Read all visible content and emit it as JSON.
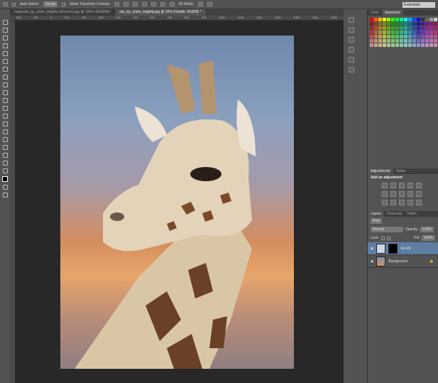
{
  "options": {
    "auto_select": "Auto-Select:",
    "group": "Group",
    "show_transform": "Show Transform Controls",
    "mode3d": "3D Mode:",
    "workspace": "Essentials"
  },
  "tabs": [
    {
      "label": "hogwarts_by_shine_brightly-d2yexm1.jpg @ 100% (RGB/8#)"
    },
    {
      "label": "sky_by_shine_brightly.jpg @ 25% (Giraffe, RGB/8) *"
    }
  ],
  "ruler": [
    "200",
    "100",
    "0",
    "100",
    "200",
    "300",
    "400",
    "500",
    "600",
    "700",
    "800",
    "900",
    "1000",
    "1100",
    "1200",
    "1300",
    "1400",
    "1500",
    "1600"
  ],
  "panels": {
    "color_tab": "Color",
    "swatches_tab": "Swatches",
    "adjustments_tab": "Adjustments",
    "styles_tab": "Styles",
    "add_adjustment": "Add an adjustment",
    "layers_tab": "Layers",
    "channels_tab": "Channels",
    "paths_tab": "Paths",
    "kind": "Kind",
    "blend": "Normal",
    "opacity_label": "Opacity:",
    "opacity": "100%",
    "lock_label": "Lock:",
    "fill_label": "Fill:",
    "fill": "100%",
    "layers": [
      {
        "name": "Giraffe",
        "selected": true
      },
      {
        "name": "Background",
        "selected": false
      }
    ]
  },
  "colors": {
    "canvas": "#282828",
    "panel": "#535353",
    "selected_layer": "#5f7da0"
  }
}
